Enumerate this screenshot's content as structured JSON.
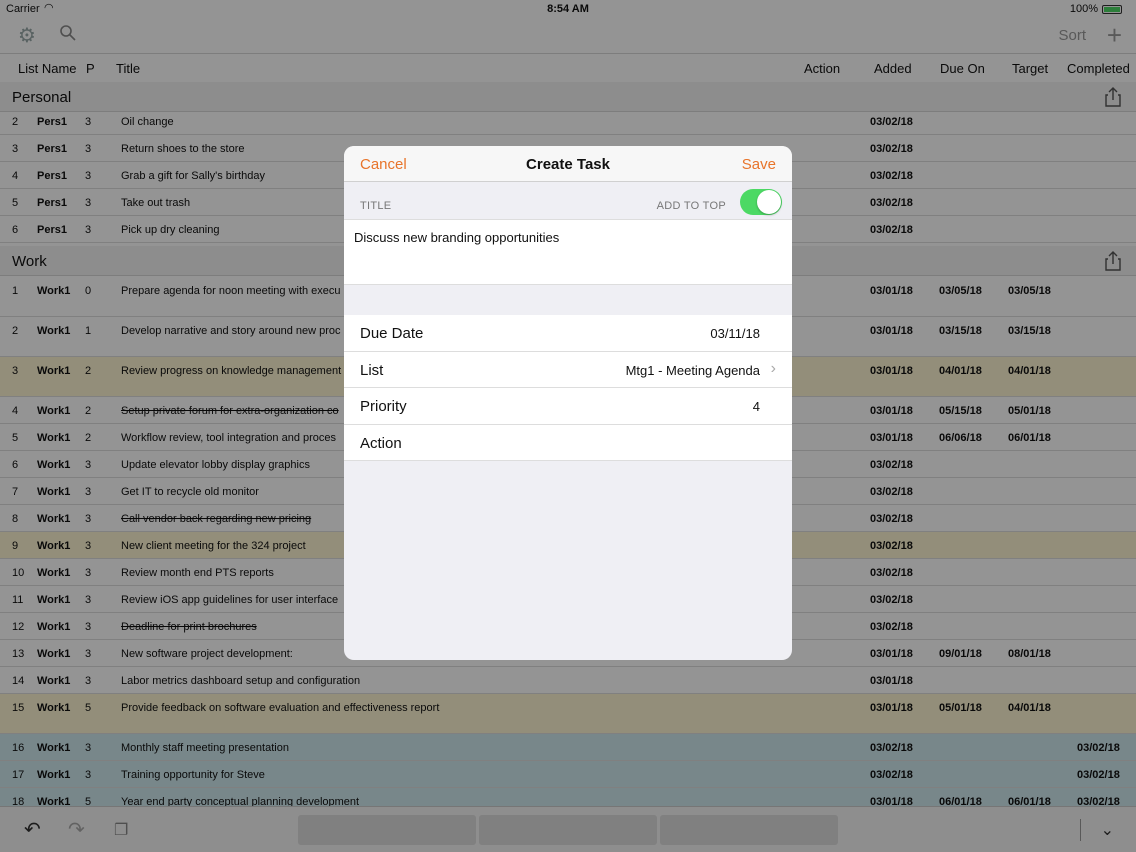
{
  "status": {
    "carrier": "Carrier",
    "time": "8:54 AM",
    "battery": "100%",
    "battery_level": 1.0
  },
  "toolbar": {
    "sort_label": "Sort"
  },
  "columns": {
    "list": "List Name",
    "p": "P",
    "title": "Title",
    "action": "Action",
    "added": "Added",
    "due": "Due On",
    "target": "Target",
    "completed": "Completed"
  },
  "sections": {
    "personal": "Personal",
    "work": "Work"
  },
  "rows": [
    {
      "n": "2",
      "list": "Pers1",
      "p": "3",
      "title": "Oil change",
      "added": "03/02/18",
      "due": "",
      "target": "",
      "done": ""
    },
    {
      "n": "3",
      "list": "Pers1",
      "p": "3",
      "title": "Return shoes to the store",
      "added": "03/02/18",
      "due": "",
      "target": "",
      "done": ""
    },
    {
      "n": "4",
      "list": "Pers1",
      "p": "3",
      "title": "Grab a gift for Sally's birthday",
      "added": "03/02/18",
      "due": "",
      "target": "",
      "done": ""
    },
    {
      "n": "5",
      "list": "Pers1",
      "p": "3",
      "title": "Take out trash",
      "added": "03/02/18",
      "due": "",
      "target": "",
      "done": ""
    },
    {
      "n": "6",
      "list": "Pers1",
      "p": "3",
      "title": "Pick up dry cleaning",
      "added": "03/02/18",
      "due": "",
      "target": "",
      "done": ""
    },
    {
      "n": "1",
      "list": "Work1",
      "p": "0",
      "title": "Prepare agenda for noon meeting with execu",
      "added": "03/01/18",
      "due": "03/05/18",
      "target": "03/05/18",
      "done": ""
    },
    {
      "n": "2",
      "list": "Work1",
      "p": "1",
      "title": "Develop narrative and story around new proc",
      "added": "03/01/18",
      "due": "03/15/18",
      "target": "03/15/18",
      "done": ""
    },
    {
      "n": "3",
      "list": "Work1",
      "p": "2",
      "title": "Review progress on knowledge management",
      "added": "03/01/18",
      "due": "04/01/18",
      "target": "04/01/18",
      "done": ""
    },
    {
      "n": "4",
      "list": "Work1",
      "p": "2",
      "title": "Setup private forum for extra-organization co",
      "added": "03/01/18",
      "due": "05/15/18",
      "target": "05/01/18",
      "done": ""
    },
    {
      "n": "5",
      "list": "Work1",
      "p": "2",
      "title": "Workflow review, tool integration and proces",
      "added": "03/01/18",
      "due": "06/06/18",
      "target": "06/01/18",
      "done": ""
    },
    {
      "n": "6",
      "list": "Work1",
      "p": "3",
      "title": "Update elevator lobby display graphics",
      "added": "03/02/18",
      "due": "",
      "target": "",
      "done": ""
    },
    {
      "n": "7",
      "list": "Work1",
      "p": "3",
      "title": "Get IT to recycle old monitor",
      "added": "03/02/18",
      "due": "",
      "target": "",
      "done": ""
    },
    {
      "n": "8",
      "list": "Work1",
      "p": "3",
      "title": "Call vendor back regarding new pricing",
      "added": "03/02/18",
      "due": "",
      "target": "",
      "done": ""
    },
    {
      "n": "9",
      "list": "Work1",
      "p": "3",
      "title": "New client meeting for the 324 project",
      "added": "03/02/18",
      "due": "",
      "target": "",
      "done": ""
    },
    {
      "n": "10",
      "list": "Work1",
      "p": "3",
      "title": "Review month end PTS reports",
      "added": "03/02/18",
      "due": "",
      "target": "",
      "done": ""
    },
    {
      "n": "11",
      "list": "Work1",
      "p": "3",
      "title": "Review iOS app guidelines for user interface",
      "added": "03/02/18",
      "due": "",
      "target": "",
      "done": ""
    },
    {
      "n": "12",
      "list": "Work1",
      "p": "3",
      "title": "Deadline for print brochures",
      "added": "03/02/18",
      "due": "",
      "target": "",
      "done": ""
    },
    {
      "n": "13",
      "list": "Work1",
      "p": "3",
      "title": "New software project development:",
      "added": "03/01/18",
      "due": "09/01/18",
      "target": "08/01/18",
      "done": ""
    },
    {
      "n": "14",
      "list": "Work1",
      "p": "3",
      "title": "Labor metrics dashboard setup and configuration",
      "added": "03/01/18",
      "due": "",
      "target": "",
      "done": ""
    },
    {
      "n": "15",
      "list": "Work1",
      "p": "5",
      "title": "Provide feedback on software evaluation and effectiveness report",
      "added": "03/01/18",
      "due": "05/01/18",
      "target": "04/01/18",
      "done": ""
    },
    {
      "n": "16",
      "list": "Work1",
      "p": "3",
      "title": "Monthly staff meeting presentation",
      "added": "03/02/18",
      "due": "",
      "target": "",
      "done": "03/02/18"
    },
    {
      "n": "17",
      "list": "Work1",
      "p": "3",
      "title": "Training opportunity for Steve",
      "added": "03/02/18",
      "due": "",
      "target": "",
      "done": "03/02/18"
    },
    {
      "n": "18",
      "list": "Work1",
      "p": "5",
      "title": "Year end party conceptual planning development",
      "added": "03/01/18",
      "due": "06/01/18",
      "target": "06/01/18",
      "done": "03/02/18"
    }
  ],
  "modal": {
    "cancel": "Cancel",
    "title": "Create Task",
    "save": "Save",
    "title_label": "TITLE",
    "add_to_top": "ADD TO TOP",
    "task_title": "Discuss new branding opportunities",
    "due_label": "Due Date",
    "due_value": "03/11/18",
    "list_label": "List",
    "list_value": "Mtg1 - Meeting Agenda",
    "priority_label": "Priority",
    "priority_value": "4",
    "action_label": "Action"
  }
}
